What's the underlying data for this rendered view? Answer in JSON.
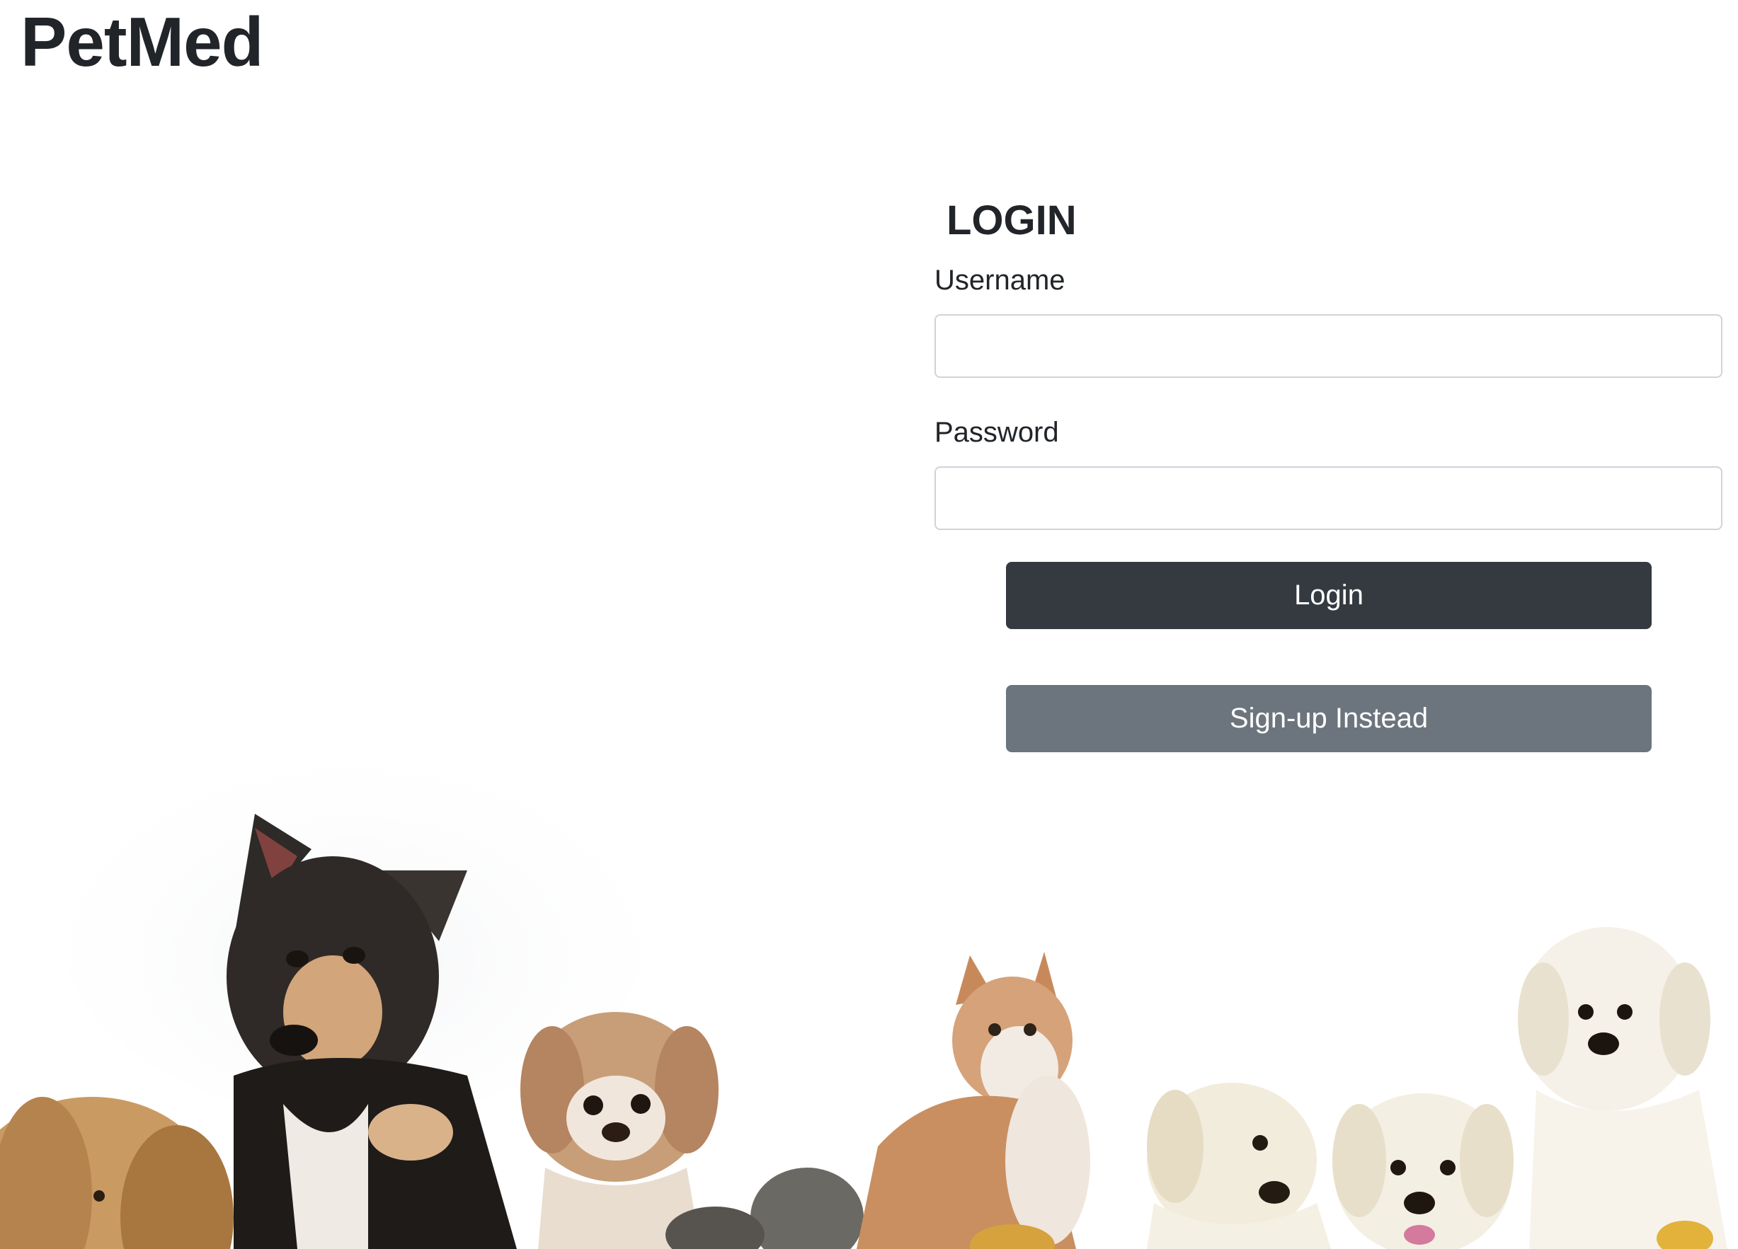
{
  "header": {
    "brand": "PetMed"
  },
  "login_form": {
    "title": "LOGIN",
    "username_label": "Username",
    "username_value": "",
    "password_label": "Password",
    "password_value": "",
    "login_button": "Login",
    "signup_button": "Sign-up Instead"
  },
  "colors": {
    "primary_button": "#343a40",
    "secondary_button": "#6c757d",
    "text": "#212529",
    "input_border": "#ced4da"
  },
  "hero_image": {
    "icon": "pets-group-photo"
  }
}
